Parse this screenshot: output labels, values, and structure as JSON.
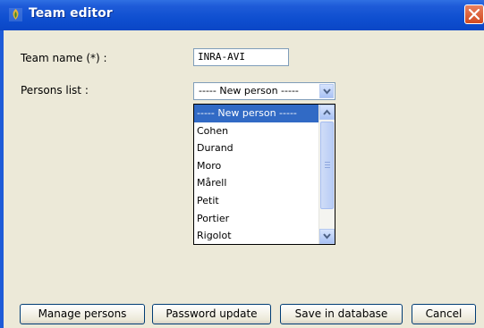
{
  "window": {
    "title": "Team editor",
    "icon": "app-icon"
  },
  "form": {
    "team_name_label": "Team name (*) :",
    "team_name_value": "INRA-AVI",
    "persons_list_label": "Persons list :",
    "persons_combo_value": "----- New person -----"
  },
  "dropdown": {
    "items": [
      "----- New person -----",
      "Cohen",
      "Durand",
      "Moro",
      "Mårell",
      "Petit",
      "Portier",
      "Rigolot"
    ],
    "selected": "----- New person -----"
  },
  "buttons": {
    "manage": "Manage persons",
    "password": "Password update",
    "save": "Save in database",
    "cancel": "Cancel"
  },
  "colors": {
    "titlebar": "#0f4fd0",
    "selection": "#316ac5",
    "dialog_bg": "#ece9d8"
  }
}
